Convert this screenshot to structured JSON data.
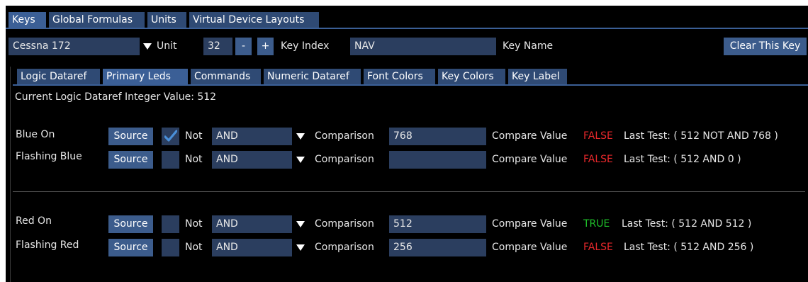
{
  "top_tabs": [
    {
      "label": "Keys",
      "active": true
    },
    {
      "label": "Global Formulas",
      "active": false
    },
    {
      "label": "Units",
      "active": false
    },
    {
      "label": "Virtual Device Layouts",
      "active": false
    }
  ],
  "toolbar": {
    "aircraft": "Cessna 172",
    "unit_label": "Unit",
    "unit_value": "32",
    "minus": "-",
    "plus": "+",
    "key_index_label": "Key Index",
    "key_index_value": "NAV",
    "key_name_label": "Key Name",
    "clear_button": "Clear This Key"
  },
  "sub_tabs": [
    {
      "label": "Logic Dataref",
      "active": false
    },
    {
      "label": "Primary Leds",
      "active": true
    },
    {
      "label": "Commands",
      "active": false
    },
    {
      "label": "Numeric Dataref",
      "active": false
    },
    {
      "label": "Font Colors",
      "active": false
    },
    {
      "label": "Key Colors",
      "active": false
    },
    {
      "label": "Key Label",
      "active": false
    }
  ],
  "current_value_text": "Current Logic Dataref Integer Value: 512",
  "rows": [
    {
      "name": "Blue On",
      "source": "Source",
      "not_checked": true,
      "not_label": "Not",
      "operator": "AND",
      "comparison_label": "Comparison",
      "comparison_value": "768",
      "compare_label": "Compare Value",
      "result": "FALSE",
      "last_test": "Last Test: ( 512 NOT AND 768 )"
    },
    {
      "name": "Flashing Blue",
      "source": "Source",
      "not_checked": false,
      "not_label": "Not",
      "operator": "AND",
      "comparison_label": "Comparison",
      "comparison_value": "",
      "compare_label": "Compare Value",
      "result": "FALSE",
      "last_test": "Last Test: ( 512 AND 0 )"
    },
    {
      "name": "Red On",
      "source": "Source",
      "not_checked": false,
      "not_label": "Not",
      "operator": "AND",
      "comparison_label": "Comparison",
      "comparison_value": "512",
      "compare_label": "Compare Value",
      "result": "TRUE",
      "last_test": "Last Test: ( 512 AND 512 )"
    },
    {
      "name": "Flashing Red",
      "source": "Source",
      "not_checked": false,
      "not_label": "Not",
      "operator": "AND",
      "comparison_label": "Comparison",
      "comparison_value": "256",
      "compare_label": "Compare Value",
      "result": "FALSE",
      "last_test": "Last Test: ( 512 AND 256 )"
    }
  ],
  "colors": {
    "background": "#000000",
    "tab": "#2f4a74",
    "tab_active": "#3b5f96",
    "field": "#2b3e5f",
    "button": "#3c5c8c",
    "true": "#1fbf2a",
    "false": "#e8282b",
    "check": "#4a90d9"
  },
  "icons": {
    "dropdown": "triangle-down",
    "checkbox": "checkmark"
  }
}
